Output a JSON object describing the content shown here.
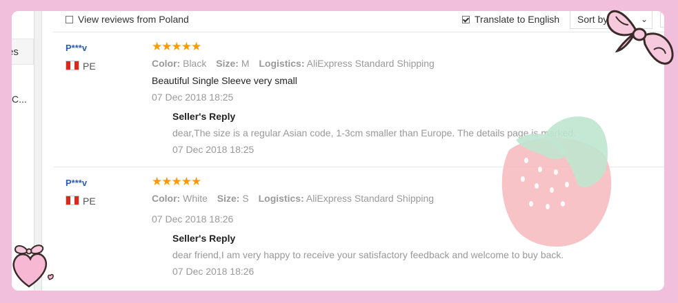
{
  "left_panel": {
    "tab_label": "es",
    "truncated_text": "C..."
  },
  "toolbar": {
    "view_poland_label": "View reviews from Poland",
    "view_poland_checked": false,
    "translate_label": "Translate to English",
    "translate_checked": true,
    "sort_label": "Sort by",
    "sort_caret": "⌄"
  },
  "reviews": [
    {
      "user": "P***v",
      "country": "PE",
      "stars": "★★★★★",
      "color_label": "Color:",
      "color": "Black",
      "size_label": "Size:",
      "size": "M",
      "logistics_label": "Logistics:",
      "logistics": "AliExpress Standard Shipping",
      "text": "Beautiful Single Sleeve very small",
      "date": "07 Dec 2018 18:25",
      "reply_title": "Seller's Reply",
      "reply_text": "dear,The size is a regular Asian code, 1-3cm smaller than Europe. The details page is marked.",
      "reply_date": "07 Dec 2018 18:25"
    },
    {
      "user": "P***v",
      "country": "PE",
      "stars": "★★★★★",
      "color_label": "Color:",
      "color": "White",
      "size_label": "Size:",
      "size": "S",
      "logistics_label": "Logistics:",
      "logistics": "AliExpress Standard Shipping",
      "text": "",
      "date": "07 Dec 2018 18:26",
      "reply_title": "Seller's Reply",
      "reply_text": "dear friend,I am very happy to receive your satisfactory feedback and welcome to buy back.",
      "reply_date": "07 Dec 2018 18:26"
    }
  ],
  "colors": {
    "frame_background": "#f1bfdc",
    "star": "#ff9a00",
    "username": "#2a5cb5",
    "muted_text": "#999999"
  },
  "icons": [
    "pink-bow-icon",
    "strawberry-icon",
    "heart-icon"
  ]
}
